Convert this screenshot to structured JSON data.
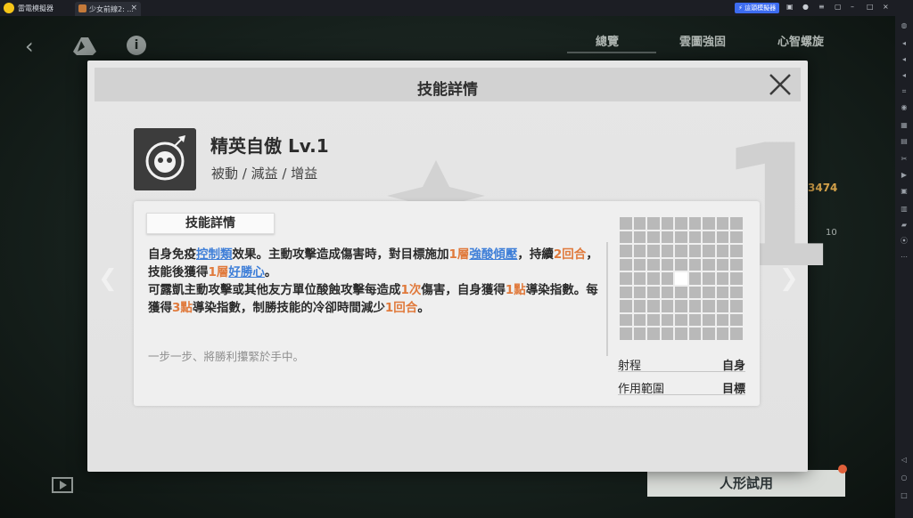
{
  "titlebar": {
    "app_name": "雷電模擬器",
    "tab_label": "少女前線2: ...",
    "sync_label": "這頭模擬器"
  },
  "game": {
    "bg_tabs": [
      "總覽",
      "雲圖強固",
      "心智螺旋"
    ],
    "bg_number": "3474",
    "bg_ten": "10",
    "try_button": "人形試用"
  },
  "modal": {
    "title": "技能詳情",
    "big_number": "1",
    "skill": {
      "name": "精英自傲 Lv.1",
      "tags": "被動 / 減益 / 增益"
    },
    "detail_tab": "技能詳情",
    "desc": {
      "p1_a": "自身免疫",
      "p1_link1": "控制類",
      "p1_b": "效果。主動攻擊造成傷害時，對目標施加",
      "p1_hl1": "1層",
      "p1_link2": "強酸傾壓",
      "p1_c": "，持續",
      "p1_hl2": "2回合",
      "p1_d": "，技能後獲得",
      "p1_hl3": "1層",
      "p1_link3": "好勝心",
      "p1_e": "。",
      "p2_a": "可露凱主動攻擊或其他友方單位酸蝕攻擊每造成",
      "p2_hl1": "1次",
      "p2_b": "傷害，自身獲得",
      "p2_hl2": "1點",
      "p2_c": "導染指數。每獲得",
      "p2_hl3": "3點",
      "p2_d": "導染指數，制勝技能的冷卻時間減少",
      "p2_hl4": "1回合",
      "p2_e": "。"
    },
    "quote": "一步一步、將勝利攥緊於手中。",
    "stats": [
      {
        "label": "射程",
        "value": "自身"
      },
      {
        "label": "作用範圍",
        "value": "目標"
      }
    ]
  },
  "colors": {
    "highlight": "#e07a3c",
    "link": "#3f7fd8",
    "accent_number": "#d4a24a"
  }
}
